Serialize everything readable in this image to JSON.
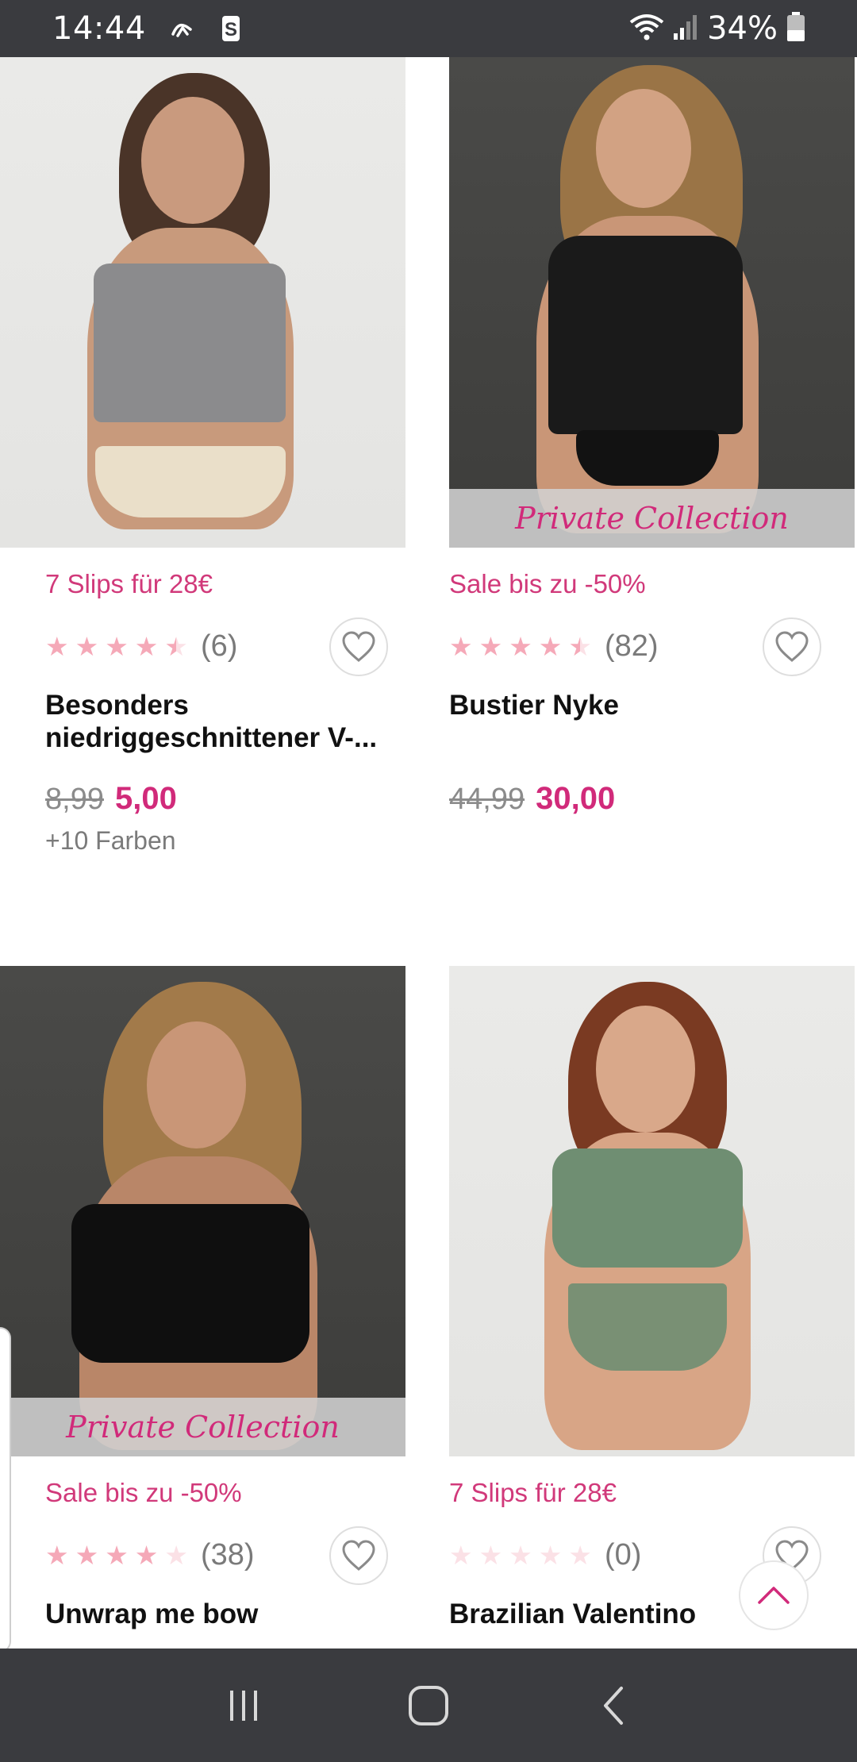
{
  "status_bar": {
    "time": "14:44",
    "battery": "34%",
    "icons": [
      "signal-arrows-icon",
      "s-app-icon",
      "wifi-icon",
      "cell-signal-icon",
      "battery-icon"
    ]
  },
  "products": [
    {
      "promo": "7 Slips für 28€",
      "rating": 4.5,
      "rating_count": "(6)",
      "title": "Besonders niedriggeschnittener V-...",
      "old_price": "8,99",
      "new_price": "5,00",
      "colors": "+10 Farben",
      "private_collection": false
    },
    {
      "promo": "Sale bis zu -50%",
      "rating": 4.5,
      "rating_count": "(82)",
      "title": "Bustier Nyke",
      "old_price": "44,99",
      "new_price": "30,00",
      "colors": "",
      "private_collection": true
    },
    {
      "promo": "Sale bis zu -50%",
      "rating": 4,
      "rating_count": "(38)",
      "title": "Unwrap me bow",
      "old_price": "",
      "new_price": "",
      "colors": "",
      "private_collection": true
    },
    {
      "promo": "7 Slips für 28€",
      "rating": 0,
      "rating_count": "(0)",
      "title": "Brazilian Valentino",
      "old_price": "",
      "new_price": "",
      "colors": "",
      "private_collection": false
    }
  ],
  "banner_text": "Private Collection",
  "colors": {
    "accent": "#d12a7a",
    "star_filled": "#f5a9b8",
    "star_empty": "#fbe1e6",
    "bars": "#3a3b3f"
  }
}
